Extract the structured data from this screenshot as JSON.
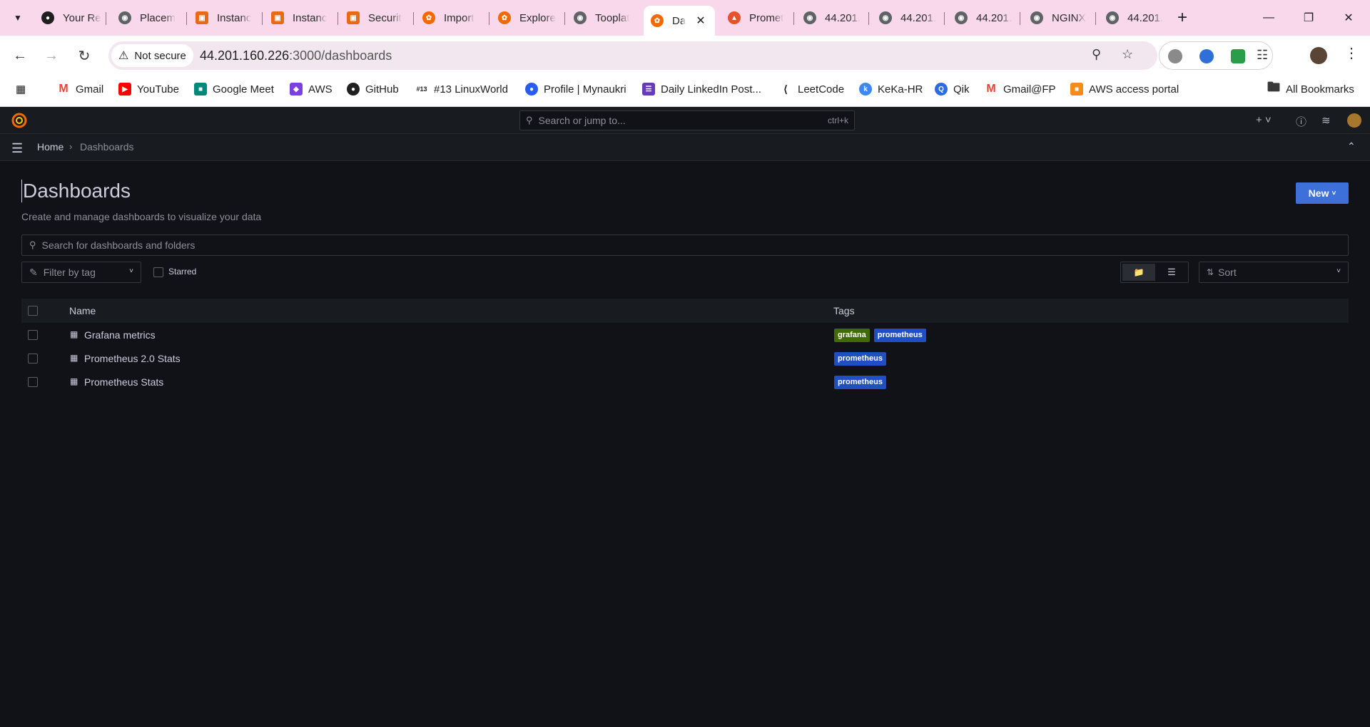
{
  "browser": {
    "tabs": [
      {
        "label": "Your Re",
        "icon": "github-icon"
      },
      {
        "label": "Placem",
        "icon": "globe-icon"
      },
      {
        "label": "Instanc",
        "icon": "aws-icon"
      },
      {
        "label": "Instanc",
        "icon": "aws-icon"
      },
      {
        "label": "Securit",
        "icon": "aws-icon"
      },
      {
        "label": "Import",
        "icon": "grafana-icon"
      },
      {
        "label": "Explore",
        "icon": "grafana-icon"
      },
      {
        "label": "Tooplat",
        "icon": "globe-icon"
      },
      {
        "label": "Da",
        "icon": "grafana-icon",
        "active": true
      },
      {
        "label": "Promet",
        "icon": "prometheus-icon"
      },
      {
        "label": "44.201.",
        "icon": "globe-icon"
      },
      {
        "label": "44.201.",
        "icon": "globe-icon"
      },
      {
        "label": "44.201.",
        "icon": "globe-icon"
      },
      {
        "label": "NGINX",
        "icon": "globe-icon"
      },
      {
        "label": "44.201.",
        "icon": "globe-icon"
      }
    ],
    "security_label": "Not secure",
    "url_host": "44.201.160.226",
    "url_path": ":3000/dashboards",
    "bookmarks": [
      {
        "label": "Gmail",
        "icon": "gmail-icon"
      },
      {
        "label": "YouTube",
        "icon": "youtube-icon"
      },
      {
        "label": "Google Meet",
        "icon": "meet-icon"
      },
      {
        "label": "AWS",
        "icon": "aws-icon"
      },
      {
        "label": "GitHub",
        "icon": "github-icon"
      },
      {
        "label": "#13 LinuxWorld",
        "icon": "linuxworld-icon"
      },
      {
        "label": "Profile | Mynaukri",
        "icon": "naukri-icon"
      },
      {
        "label": "Daily LinkedIn Post...",
        "icon": "forms-icon"
      },
      {
        "label": "LeetCode",
        "icon": "leetcode-icon"
      },
      {
        "label": "KeKa-HR",
        "icon": "keka-icon"
      },
      {
        "label": "Qik",
        "icon": "qik-icon"
      },
      {
        "label": "Gmail@FP",
        "icon": "gmail-icon"
      },
      {
        "label": "AWS access portal",
        "icon": "aws-cube-icon"
      }
    ],
    "all_bookmarks_label": "All Bookmarks"
  },
  "grafana": {
    "search_placeholder": "Search or jump to...",
    "search_shortcut": "ctrl+k",
    "breadcrumb": {
      "home": "Home",
      "current": "Dashboards"
    },
    "title": "Dashboards",
    "subtitle": "Create and manage dashboards to visualize your data",
    "new_button": "New",
    "dash_search_placeholder": "Search for dashboards and folders",
    "filter_by_tag": "Filter by tag",
    "starred_label": "Starred",
    "sort_label": "Sort",
    "columns": {
      "name": "Name",
      "tags": "Tags"
    },
    "rows": [
      {
        "name": "Grafana metrics",
        "tags": [
          "grafana",
          "prometheus"
        ]
      },
      {
        "name": "Prometheus 2.0 Stats",
        "tags": [
          "prometheus"
        ]
      },
      {
        "name": "Prometheus Stats",
        "tags": [
          "prometheus"
        ]
      }
    ],
    "tag_colors": {
      "grafana": "#3f6b00",
      "prometheus": "#1f4fc1"
    }
  }
}
